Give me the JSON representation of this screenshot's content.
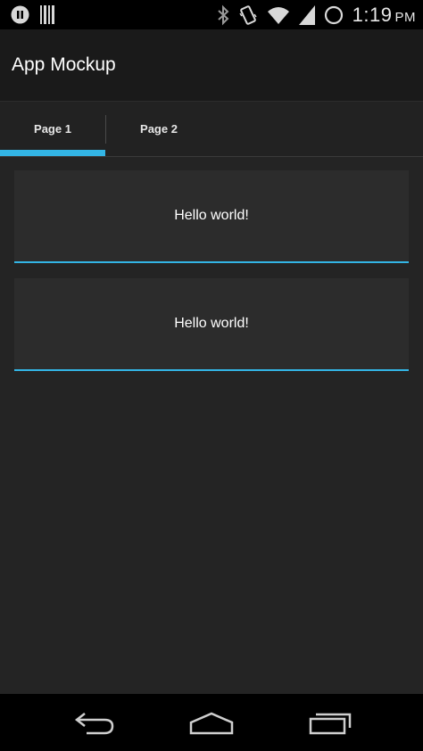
{
  "status_bar": {
    "time": "1:19",
    "time_suffix": "PM",
    "icons": [
      "pause-icon",
      "barcode-icon",
      "bluetooth-icon",
      "vibrate-icon",
      "wifi-icon",
      "signal-icon",
      "battery-icon"
    ]
  },
  "action_bar": {
    "title": "App Mockup"
  },
  "tabs": [
    {
      "label": "Page 1",
      "selected": true
    },
    {
      "label": "Page 2",
      "selected": false
    }
  ],
  "cards": [
    {
      "text": "Hello world!"
    },
    {
      "text": "Hello world!"
    }
  ],
  "colors": {
    "accent": "#33b5e5",
    "background": "#242424",
    "action_bar": "#1a1a1a",
    "card": "#2c2c2c"
  },
  "nav_bar": {
    "buttons": [
      "back-icon",
      "home-icon",
      "recents-icon"
    ]
  }
}
